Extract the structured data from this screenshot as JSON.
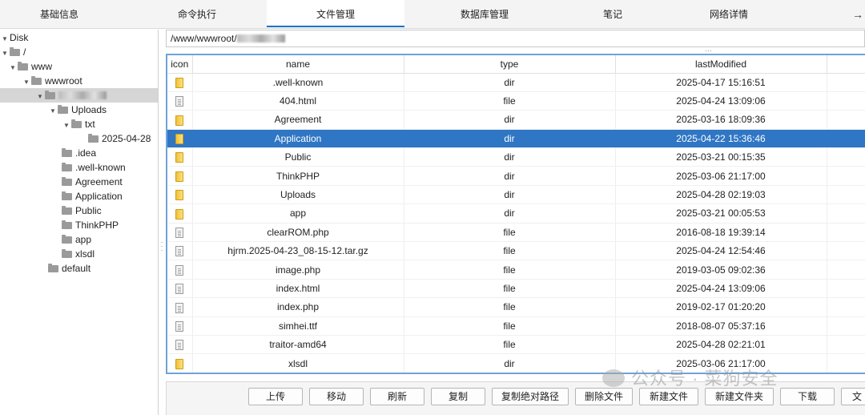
{
  "tabs": [
    "基础信息",
    "命令执行",
    "文件管理",
    "数据库管理",
    "笔记",
    "网络详情"
  ],
  "tab_more": "→",
  "tree": {
    "disk": "Disk",
    "root": "/",
    "www": "www",
    "wwwroot": "wwwroot",
    "uploads": "Uploads",
    "txt": "txt",
    "date_folder": "2025-04-28",
    "idea": ".idea",
    "well_known": ".well-known",
    "agreement": "Agreement",
    "application": "Application",
    "public": "Public",
    "thinkphp": "ThinkPHP",
    "app": "app",
    "xlsdl": "xlsdl",
    "default": "default"
  },
  "path": "/www/wwwroot/",
  "columns": [
    "icon",
    "name",
    "type",
    "lastModified"
  ],
  "files": [
    {
      "name": ".well-known",
      "type": "dir",
      "modified": "2025-04-17 15:16:51"
    },
    {
      "name": "404.html",
      "type": "file",
      "modified": "2025-04-24 13:09:06"
    },
    {
      "name": "Agreement",
      "type": "dir",
      "modified": "2025-03-16 18:09:36"
    },
    {
      "name": "Application",
      "type": "dir",
      "modified": "2025-04-22 15:36:46"
    },
    {
      "name": "Public",
      "type": "dir",
      "modified": "2025-03-21 00:15:35"
    },
    {
      "name": "ThinkPHP",
      "type": "dir",
      "modified": "2025-03-06 21:17:00"
    },
    {
      "name": "Uploads",
      "type": "dir",
      "modified": "2025-04-28 02:19:03"
    },
    {
      "name": "app",
      "type": "dir",
      "modified": "2025-03-21 00:05:53"
    },
    {
      "name": "clearROM.php",
      "type": "file",
      "modified": "2016-08-18 19:39:14"
    },
    {
      "name": "hjrm.2025-04-23_08-15-12.tar.gz",
      "type": "file",
      "modified": "2025-04-24 12:54:46"
    },
    {
      "name": "image.php",
      "type": "file",
      "modified": "2019-03-05 09:02:36"
    },
    {
      "name": "index.html",
      "type": "file",
      "modified": "2025-04-24 13:09:06"
    },
    {
      "name": "index.php",
      "type": "file",
      "modified": "2019-02-17 01:20:20"
    },
    {
      "name": "simhei.ttf",
      "type": "file",
      "modified": "2018-08-07 05:37:16"
    },
    {
      "name": "traitor-amd64",
      "type": "file",
      "modified": "2025-04-28 02:21:01"
    },
    {
      "name": "xlsdl",
      "type": "dir",
      "modified": "2025-03-06 21:17:00"
    }
  ],
  "selected_file": "Application",
  "buttons": [
    "上传",
    "移动",
    "刷新",
    "复制",
    "复制绝对路径",
    "删除文件",
    "新建文件",
    "新建文件夹",
    "下载",
    "文"
  ],
  "watermark": "公众号 · 菜狗安全",
  "colors": {
    "selection": "#2f76c4",
    "accent": "#1a73c9"
  }
}
